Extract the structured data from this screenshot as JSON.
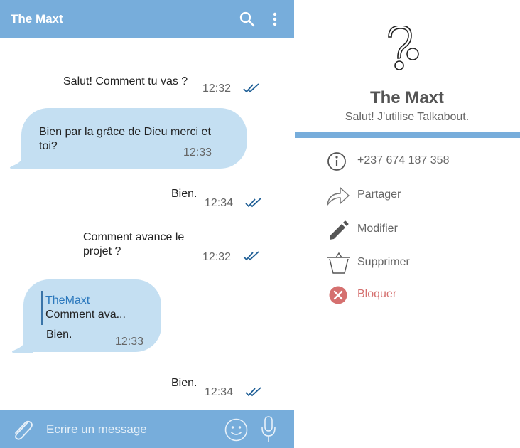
{
  "chat": {
    "title": "The Maxt",
    "input_placeholder": "Ecrire un message",
    "messages": [
      {
        "direction": "out",
        "text": "Salut! Comment tu vas ?",
        "time": "12:32",
        "read": true
      },
      {
        "direction": "in",
        "text": "Bien par la grâce de Dieu merci et toi?",
        "time": "12:33"
      },
      {
        "direction": "out",
        "text": "Bien.",
        "time": "12:34",
        "read": true
      },
      {
        "direction": "out",
        "text": "Comment avance le projet ?",
        "time": "12:32",
        "read": true
      },
      {
        "direction": "in",
        "reply_to": {
          "name": "TheMaxt",
          "text": "Comment ava..."
        },
        "text": "Bien.",
        "time": "12:33"
      },
      {
        "direction": "out",
        "text": "Bien.",
        "time": "12:34",
        "read": true
      }
    ]
  },
  "profile": {
    "name": "The Maxt",
    "status": "Salut! J'utilise Talkabout.",
    "actions": [
      {
        "icon": "info-icon",
        "label": "+237 674 187 358"
      },
      {
        "icon": "share-icon",
        "label": "Partager"
      },
      {
        "icon": "pencil-icon",
        "label": "Modifier"
      },
      {
        "icon": "trash-icon",
        "label": "Supprimer"
      },
      {
        "icon": "block-icon",
        "label": "Bloquer"
      }
    ]
  },
  "colors": {
    "accent": "#77addb",
    "bubble_in": "#c4dff2",
    "danger": "#d5706f",
    "tick": "#1f5f96"
  }
}
